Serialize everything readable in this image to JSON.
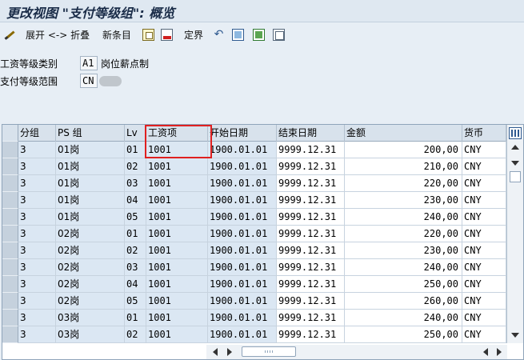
{
  "window": {
    "title": "更改视图 \"支付等级组\": 概览"
  },
  "toolbar": {
    "expand_collapse_label": "展开 <-> 折叠",
    "new_entries_label": "新条目",
    "delimit_label": "定界"
  },
  "fields": {
    "pay_scale_type": {
      "label": "工资等级类别",
      "value": "A1",
      "description": "岗位薪点制"
    },
    "pay_scale_area": {
      "label": "支付等级范围",
      "value": "CN"
    }
  },
  "table": {
    "columns": [
      "分组",
      "PS 组",
      "Lv",
      "工资项",
      "开始日期",
      "结束日期",
      "金额",
      "货币"
    ],
    "rows": [
      [
        "3",
        "01岗",
        "01",
        "1001",
        "1900.01.01",
        "9999.12.31",
        "200,00",
        "CNY"
      ],
      [
        "3",
        "01岗",
        "02",
        "1001",
        "1900.01.01",
        "9999.12.31",
        "210,00",
        "CNY"
      ],
      [
        "3",
        "01岗",
        "03",
        "1001",
        "1900.01.01",
        "9999.12.31",
        "220,00",
        "CNY"
      ],
      [
        "3",
        "01岗",
        "04",
        "1001",
        "1900.01.01",
        "9999.12.31",
        "230,00",
        "CNY"
      ],
      [
        "3",
        "01岗",
        "05",
        "1001",
        "1900.01.01",
        "9999.12.31",
        "240,00",
        "CNY"
      ],
      [
        "3",
        "02岗",
        "01",
        "1001",
        "1900.01.01",
        "9999.12.31",
        "220,00",
        "CNY"
      ],
      [
        "3",
        "02岗",
        "02",
        "1001",
        "1900.01.01",
        "9999.12.31",
        "230,00",
        "CNY"
      ],
      [
        "3",
        "02岗",
        "03",
        "1001",
        "1900.01.01",
        "9999.12.31",
        "240,00",
        "CNY"
      ],
      [
        "3",
        "02岗",
        "04",
        "1001",
        "1900.01.01",
        "9999.12.31",
        "250,00",
        "CNY"
      ],
      [
        "3",
        "02岗",
        "05",
        "1001",
        "1900.01.01",
        "9999.12.31",
        "260,00",
        "CNY"
      ],
      [
        "3",
        "03岗",
        "01",
        "1001",
        "1900.01.01",
        "9999.12.31",
        "240,00",
        "CNY"
      ],
      [
        "3",
        "03岗",
        "02",
        "1001",
        "1900.01.01",
        "9999.12.31",
        "250,00",
        "CNY"
      ]
    ]
  },
  "colors": {
    "highlight": "#e02020",
    "key_cell": "#dbe7f3",
    "header": "#d8e2ec"
  }
}
